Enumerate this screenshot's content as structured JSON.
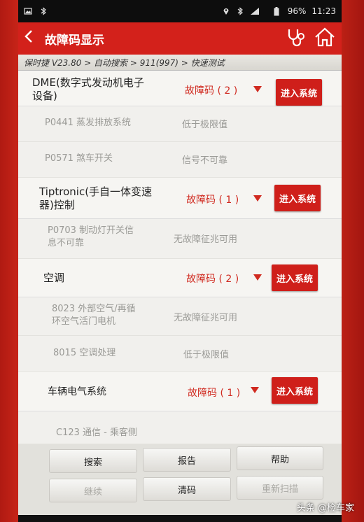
{
  "status_bar": {
    "battery": "96%",
    "time": "11:23"
  },
  "header": {
    "title": "故障码显示",
    "back_icon": "arrow-left-icon",
    "icons": [
      "stethoscope-icon",
      "home-icon"
    ]
  },
  "breadcrumb": "保时捷 V23.80 > 自动搜索 > 911(997) > 快速测试",
  "systems": [
    {
      "name_line1": "DME(数字式发动机电子",
      "name_line2": "设备)",
      "count": "故障码 ( 2 )",
      "button": "进入系统",
      "codes": [
        {
          "code": "P0441 蒸发排放系统",
          "code2": "",
          "desc": "低于极限值"
        },
        {
          "code": "P0571 煞车开关",
          "code2": "",
          "desc": "信号不可靠"
        }
      ]
    },
    {
      "name_line1": "Tiptronic(手自一体变速",
      "name_line2": "器)控制",
      "count": "故障码 ( 1 )",
      "button": "进入系统",
      "codes": [
        {
          "code": "P0703 制动灯开关信",
          "code2": "息不可靠",
          "desc": "无故障征兆可用"
        }
      ]
    },
    {
      "name_line1": "空调",
      "name_line2": "",
      "count": "故障码 ( 2 )",
      "button": "进入系统",
      "codes": [
        {
          "code": "8023 外部空气/再循",
          "code2": "环空气活门电机",
          "desc": "无故障征兆可用"
        },
        {
          "code": "8015 空调处理",
          "code2": "",
          "desc": "低于极限值"
        }
      ]
    },
    {
      "name_line1": "车辆电气系统",
      "name_line2": "",
      "count": "故障码 ( 1 )",
      "button": "进入系统",
      "codes": [
        {
          "code": "C123 通信 - 乘客侧",
          "code2": "",
          "desc": ""
        }
      ]
    }
  ],
  "bottom_buttons": {
    "search": "搜索",
    "report": "报告",
    "help": "帮助",
    "continue": "继续",
    "clear": "清码",
    "rescan": "重新扫描"
  },
  "watermark": "头条 @检车家",
  "colors": {
    "title_bar": "#d3211b",
    "fault_count": "#d02a20",
    "enter_button": "#cf1f1a"
  }
}
